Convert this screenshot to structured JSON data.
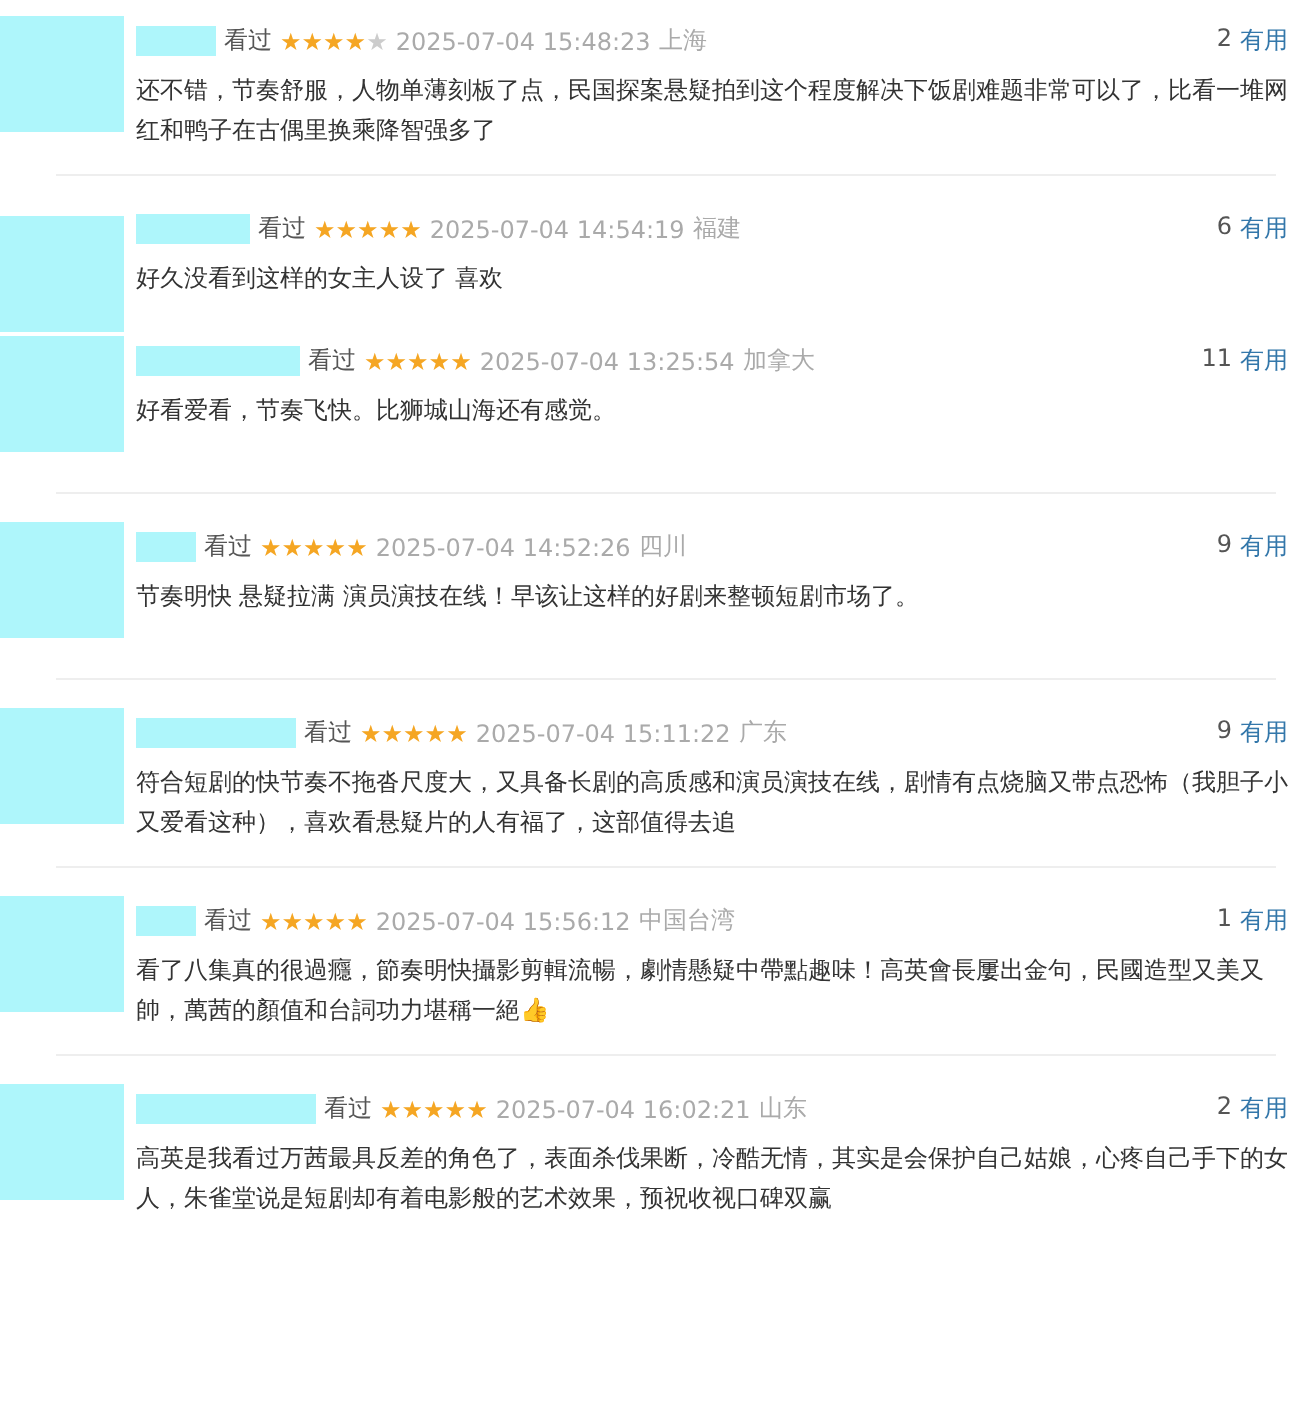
{
  "reviews": [
    {
      "watched": "看过",
      "stars": 4,
      "time": "2025-07-04 15:48:23",
      "location": "上海",
      "useful_count": "2",
      "useful_label": "有用",
      "text": "还不错，节奏舒服，人物单薄刻板了点，民国探案悬疑拍到这个程度解决下饭剧难题非常可以了，比看一堆网红和鸭子在古偶里换乘降智强多了"
    },
    {
      "watched": "看过",
      "stars": 5,
      "time": "2025-07-04 14:54:19",
      "location": "福建",
      "useful_count": "6",
      "useful_label": "有用",
      "text": "好久没看到这样的女主人设了 喜欢"
    },
    {
      "watched": "看过",
      "stars": 5,
      "time": "2025-07-04 13:25:54",
      "location": "加拿大",
      "useful_count": "11",
      "useful_label": "有用",
      "text": "好看爱看，节奏飞快。比狮城山海还有感觉。"
    },
    {
      "watched": "看过",
      "stars": 5,
      "time": "2025-07-04 14:52:26",
      "location": "四川",
      "useful_count": "9",
      "useful_label": "有用",
      "text": "节奏明快 悬疑拉满 演员演技在线！早该让这样的好剧来整顿短剧市场了。"
    },
    {
      "watched": "看过",
      "stars": 5,
      "time": "2025-07-04 15:11:22",
      "location": "广东",
      "useful_count": "9",
      "useful_label": "有用",
      "text": "符合短剧的快节奏不拖沓尺度大，又具备长剧的高质感和演员演技在线，剧情有点烧脑又带点恐怖（我胆子小又爱看这种），喜欢看悬疑片的人有福了，这部值得去追"
    },
    {
      "watched": "看过",
      "stars": 5,
      "time": "2025-07-04 15:56:12",
      "location": "中国台湾",
      "useful_count": "1",
      "useful_label": "有用",
      "text": "看了八集真的很過癮，節奏明快攝影剪輯流暢，劇情懸疑中帶點趣味！高英會長屢出金句，民國造型又美又帥，萬茜的顏值和台詞功力堪稱一絕👍"
    },
    {
      "watched": "看过",
      "stars": 5,
      "time": "2025-07-04 16:02:21",
      "location": "山东",
      "useful_count": "2",
      "useful_label": "有用",
      "text": "高英是我看过万茜最具反差的角色了，表面杀伐果断，冷酷无情，其实是会保护自己姑娘，心疼自己手下的女人，朱雀堂说是短剧却有着电影般的艺术效果，预祝收视口碑双赢"
    }
  ]
}
